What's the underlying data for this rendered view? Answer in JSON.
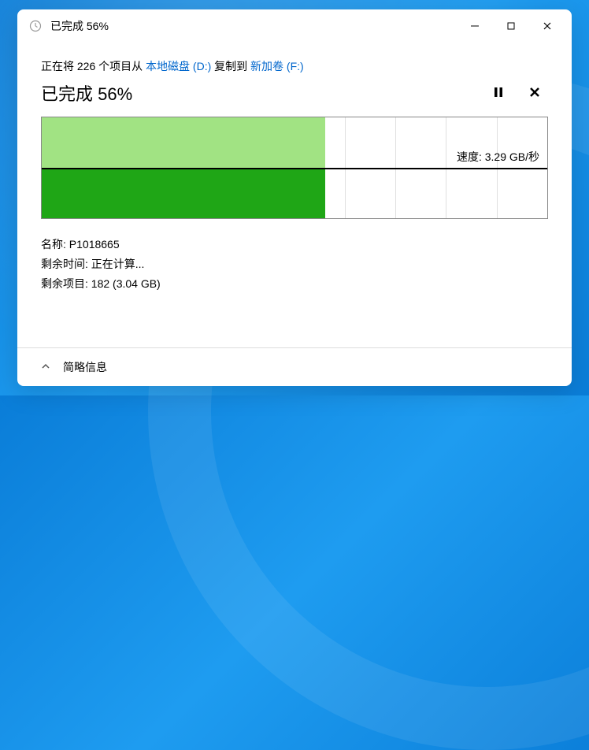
{
  "titlebar": {
    "title": "已完成 56%"
  },
  "content": {
    "copy_prefix": "正在将 226 个项目从 ",
    "source_link": "本地磁盘 (D:)",
    "copy_mid": " 复制到 ",
    "dest_link": "新加卷 (F:)",
    "progress_title": "已完成 56%",
    "speed_label": "速度: 3.29 GB/秒",
    "name_label": "名称: ",
    "name_value": "P1018665",
    "time_label": "剩余时间: ",
    "time_value": "正在计算...",
    "remaining_label": "剩余项目: ",
    "remaining_value": "182 (3.04 GB)"
  },
  "footer": {
    "toggle_label": "简略信息"
  },
  "chart_data": {
    "type": "area",
    "title": "Transfer speed",
    "ylabel": "速度",
    "progress_percent": 56,
    "average_speed": "3.29 GB/秒",
    "grid_columns": 10,
    "note": "Upper light-green band is historical speed area; lower solid green is current progress fill. Horizontal line marks average speed.",
    "x": [
      0,
      10,
      20,
      30,
      40,
      50,
      56
    ],
    "speed_values": [
      3.2,
      3.3,
      3.25,
      3.3,
      3.29,
      3.3,
      3.29
    ]
  }
}
